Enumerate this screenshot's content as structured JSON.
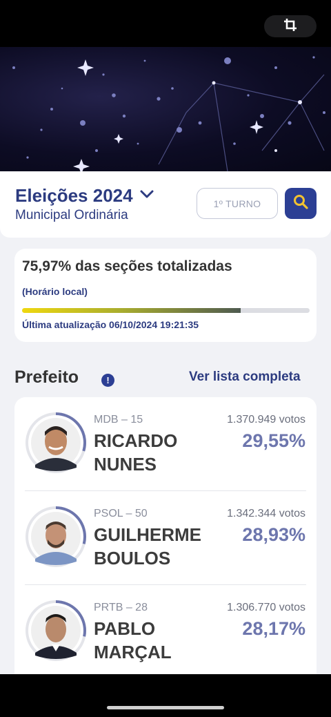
{
  "header": {
    "title": "Eleições 2024",
    "subtitle": "Municipal Ordinária",
    "turno_label": "1º TURNO"
  },
  "progress": {
    "headline": "75,97% das seções totalizadas",
    "local_time_label": "(Horário local)",
    "fraction": 0.7597,
    "last_update": "Última atualização 06/10/2024 19:21:35"
  },
  "section": {
    "title": "Prefeito",
    "see_all": "Ver lista completa"
  },
  "candidates": [
    {
      "party": "MDB – 15",
      "name_line1": "RICARDO",
      "name_line2": "NUNES",
      "votes": "1.370.949 votos",
      "percent": "29,55%"
    },
    {
      "party": "PSOL – 50",
      "name_line1": "GUILHERME",
      "name_line2": "BOULOS",
      "votes": "1.342.344 votos",
      "percent": "28,93%"
    },
    {
      "party": "PRTB – 28",
      "name_line1": "PABLO",
      "name_line2": "MARÇAL",
      "votes": "1.306.770 votos",
      "percent": "28,17%"
    }
  ],
  "colors": {
    "primary": "#2c3b80",
    "percent": "#6d76ad",
    "progress_start": "#efd810",
    "progress_end": "#4e5a50"
  },
  "icons": {
    "crop": "crop-icon",
    "chevron": "chevron-down-icon",
    "search": "search-icon",
    "info": "info-icon"
  }
}
